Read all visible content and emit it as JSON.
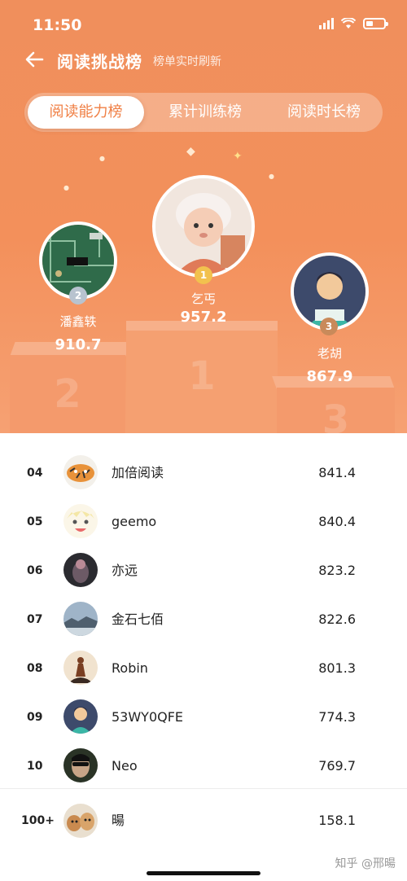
{
  "status_bar": {
    "time": "11:50"
  },
  "nav": {
    "title": "阅读挑战榜",
    "subtitle": "榜单实时刷新"
  },
  "tabs": [
    {
      "label": "阅读能力榜",
      "active": true
    },
    {
      "label": "累计训练榜",
      "active": false
    },
    {
      "label": "阅读时长榜",
      "active": false
    }
  ],
  "podium": {
    "first": {
      "rank": "1",
      "name": "乞丐",
      "score": "957.2"
    },
    "second": {
      "rank": "2",
      "name": "潘鑫轶",
      "score": "910.7"
    },
    "third": {
      "rank": "3",
      "name": "老胡",
      "score": "867.9"
    },
    "block_numbers": [
      "2",
      "1",
      "3"
    ]
  },
  "ranking": [
    {
      "rank": "04",
      "name": "加倍阅读",
      "score": "841.4",
      "avatar": "tiger-avatar"
    },
    {
      "rank": "05",
      "name": "geemo",
      "score": "840.4",
      "avatar": "cartoon-avatar"
    },
    {
      "rank": "06",
      "name": "亦远",
      "score": "823.2",
      "avatar": "dark-photo-avatar"
    },
    {
      "rank": "07",
      "name": "金石七佰",
      "score": "822.6",
      "avatar": "landscape-avatar"
    },
    {
      "rank": "08",
      "name": "Robin",
      "score": "801.3",
      "avatar": "silhouette-avatar"
    },
    {
      "rank": "09",
      "name": "53WY0QFE",
      "score": "774.3",
      "avatar": "default-reader-avatar"
    },
    {
      "rank": "10",
      "name": "Neo",
      "score": "769.7",
      "avatar": "neo-avatar"
    }
  ],
  "my_rank": {
    "rank": "100+",
    "name": "暘",
    "score": "158.1",
    "avatar": "dogs-avatar"
  },
  "watermark": "知乎 @邢暘",
  "colors": {
    "accent": "#f07f44",
    "header_bg": "#f3905b",
    "gold": "#f2c14e",
    "silver": "#b8c3cf",
    "bronze": "#c98a5a"
  }
}
